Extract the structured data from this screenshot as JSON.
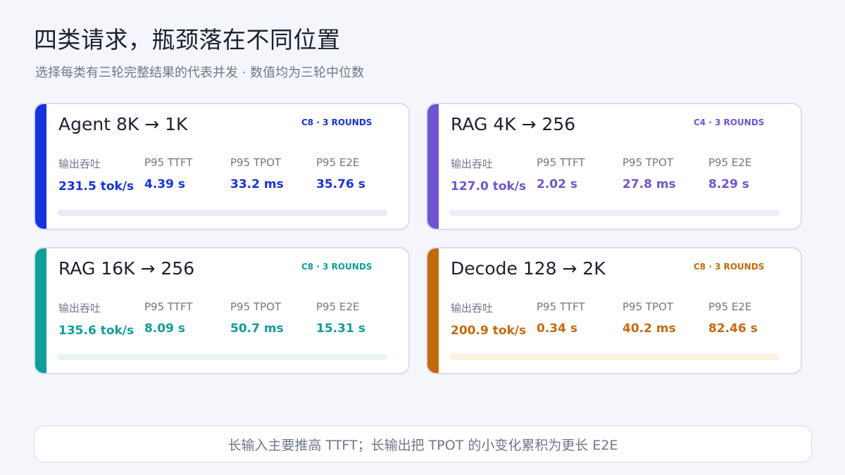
{
  "title": "四类请求，瓶颈落在不同位置",
  "subtitle": "选择每类有三轮完整结果的代表并发 · 数值均为三轮中位数",
  "cards": [
    {
      "name": "Agent 8K → 1K",
      "tag": "C8 · 3 ROUNDS",
      "color": "#1533e0",
      "bar_color": "#e9ebf9",
      "metrics": [
        {
          "label": "输出吞吐",
          "value": "231.5 tok/s"
        },
        {
          "label": "P95 TTFT",
          "value": "4.39 s"
        },
        {
          "label": "P95 TPOT",
          "value": "33.2 ms"
        },
        {
          "label": "P95 E2E",
          "value": "35.76 s"
        }
      ]
    },
    {
      "name": "RAG 4K → 256",
      "tag": "C4 · 3 ROUNDS",
      "color": "#6e55d3",
      "bar_color": "#efedfb",
      "metrics": [
        {
          "label": "输出吞吐",
          "value": "127.0 tok/s"
        },
        {
          "label": "P95 TTFT",
          "value": "2.02 s"
        },
        {
          "label": "P95 TPOT",
          "value": "27.8 ms"
        },
        {
          "label": "P95 E2E",
          "value": "8.29 s"
        }
      ]
    },
    {
      "name": "RAG 16K → 256",
      "tag": "C8 · 3 ROUNDS",
      "color": "#0e9e98",
      "bar_color": "#e6f6f6",
      "metrics": [
        {
          "label": "输出吞吐",
          "value": "135.6 tok/s"
        },
        {
          "label": "P95 TTFT",
          "value": "8.09 s"
        },
        {
          "label": "P95 TPOT",
          "value": "50.7 ms"
        },
        {
          "label": "P95 E2E",
          "value": "15.31 s"
        }
      ]
    },
    {
      "name": "Decode 128 → 2K",
      "tag": "C8 · 3 ROUNDS",
      "color": "#c56a0b",
      "bar_color": "#fdf1e0",
      "metrics": [
        {
          "label": "输出吞吐",
          "value": "200.9 tok/s"
        },
        {
          "label": "P95 TTFT",
          "value": "0.34 s"
        },
        {
          "label": "P95 TPOT",
          "value": "40.2 ms"
        },
        {
          "label": "P95 E2E",
          "value": "82.46 s"
        }
      ]
    }
  ],
  "footer": "长输入主要推高 TTFT；长输出把 TPOT 的小变化累积为更长 E2E"
}
